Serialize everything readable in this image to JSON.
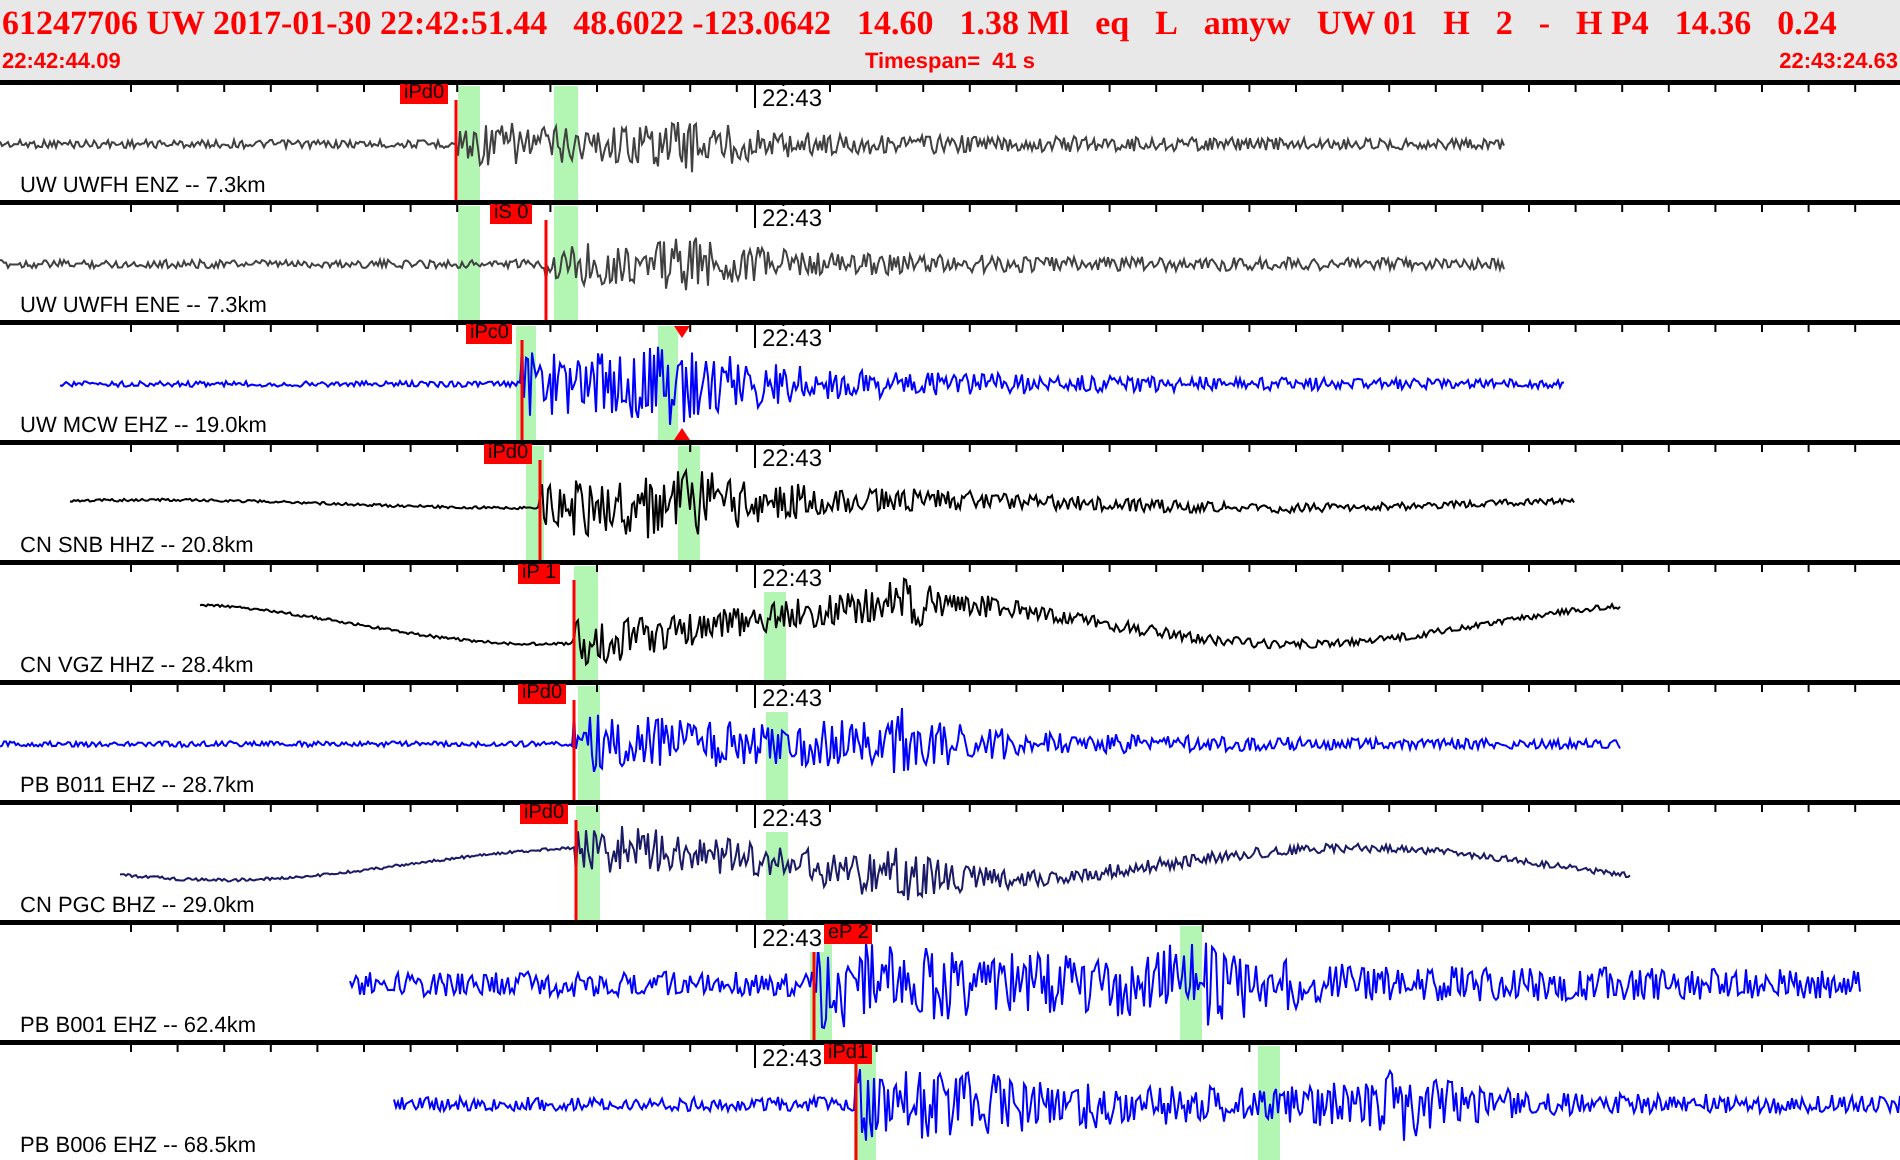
{
  "header": {
    "event_line": [
      "61247706 UW 2017-01-30 22:42:51.44",
      "48.6022 -123.0642",
      "14.60",
      "1.38 Ml",
      "eq",
      "L",
      "amyw",
      "UW 01",
      "H",
      "2",
      "-",
      "H P4",
      "14.36",
      "0.24"
    ],
    "start_time": "22:42:44.09",
    "timespan": "Timespan=  41 s",
    "end_time": "22:43:24.63"
  },
  "traces": [
    {
      "station": "UW UWFH ENZ -- 7.3km",
      "pick": "iPd0",
      "time_label": "22:43",
      "color": "#404040"
    },
    {
      "station": "UW UWFH ENE -- 7.3km",
      "pick": "iS 0",
      "time_label": "22:43",
      "color": "#404040"
    },
    {
      "station": "UW MCW EHZ -- 19.0km",
      "pick": "iPc0",
      "time_label": "22:43",
      "color": "#0000ff"
    },
    {
      "station": "CN SNB HHZ -- 20.8km",
      "pick": "iPd0",
      "time_label": "22:43",
      "color": "#000000"
    },
    {
      "station": "CN VGZ HHZ -- 28.4km",
      "pick": "iP 1",
      "time_label": "22:43",
      "color": "#000000"
    },
    {
      "station": "PB B011 EHZ -- 28.7km",
      "pick": "iPd0",
      "time_label": "22:43",
      "color": "#0000ff"
    },
    {
      "station": "CN PGC BHZ -- 29.0km",
      "pick": "iPd0",
      "time_label": "22:43",
      "color": "#1a1a66"
    },
    {
      "station": "PB B001 EHZ -- 62.4km",
      "pick": "eP 2",
      "time_label": "22:43",
      "color": "#0000ff"
    },
    {
      "station": "PB B006 EHZ -- 68.5km",
      "pick": "iPd1",
      "time_label": "22:43",
      "color": "#0000ff"
    }
  ]
}
